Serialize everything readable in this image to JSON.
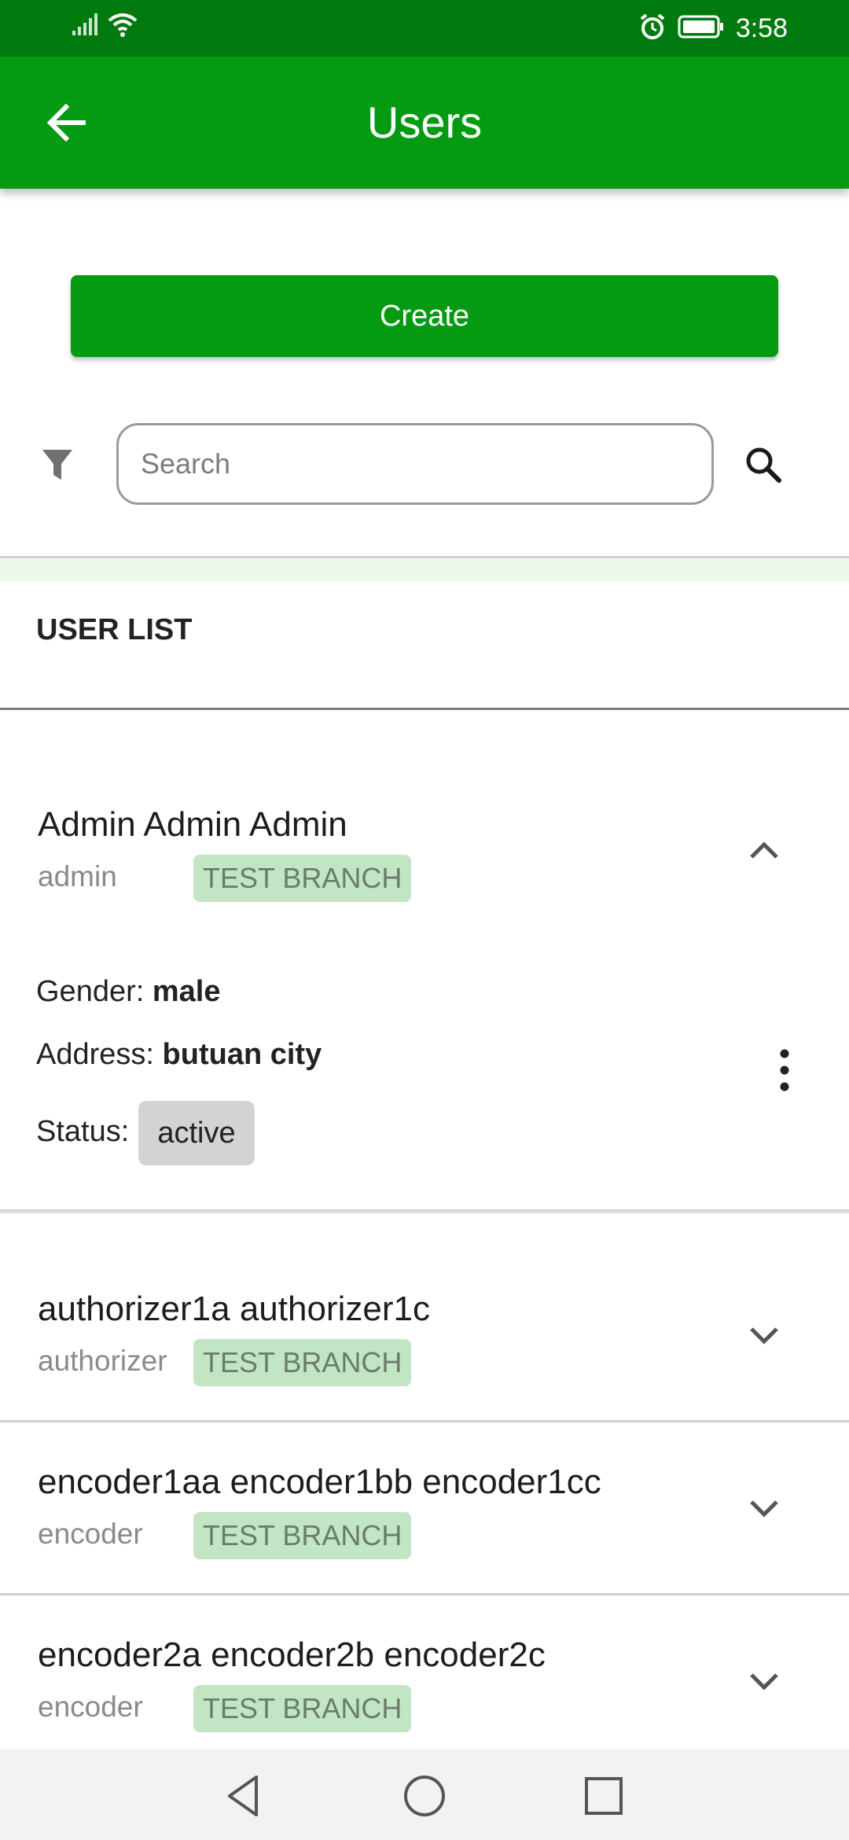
{
  "status_bar": {
    "time": "3:58",
    "icons": [
      "signal-icon",
      "wifi-icon",
      "alarm-icon",
      "battery-icon"
    ]
  },
  "app_bar": {
    "title": "Users",
    "back_icon": "arrow-left-icon"
  },
  "actions": {
    "create_label": "Create"
  },
  "search": {
    "placeholder": "Search",
    "filter_icon": "filter-icon",
    "search_icon": "search-icon"
  },
  "list": {
    "title": "USER LIST",
    "users": [
      {
        "name": "Admin Admin Admin",
        "role": "admin",
        "branch": "TEST BRANCH",
        "expanded": true,
        "details": {
          "gender_label": "Gender:",
          "gender": "male",
          "address_label": "Address:",
          "address": "butuan city",
          "status_label": "Status:",
          "status": "active"
        }
      },
      {
        "name": "authorizer1a  authorizer1c",
        "role": "authorizer",
        "branch": "TEST BRANCH",
        "expanded": false
      },
      {
        "name": "encoder1aa encoder1bb encoder1cc",
        "role": "encoder",
        "branch": "TEST BRANCH",
        "expanded": false
      },
      {
        "name": "encoder2a encoder2b encoder2c",
        "role": "encoder",
        "branch": "TEST BRANCH",
        "expanded": false
      }
    ]
  },
  "colors": {
    "status_bar": "#007a0e",
    "primary": "#049b12",
    "badge_bg": "#c2e6c4",
    "chip_bg": "#d3d3d3"
  }
}
